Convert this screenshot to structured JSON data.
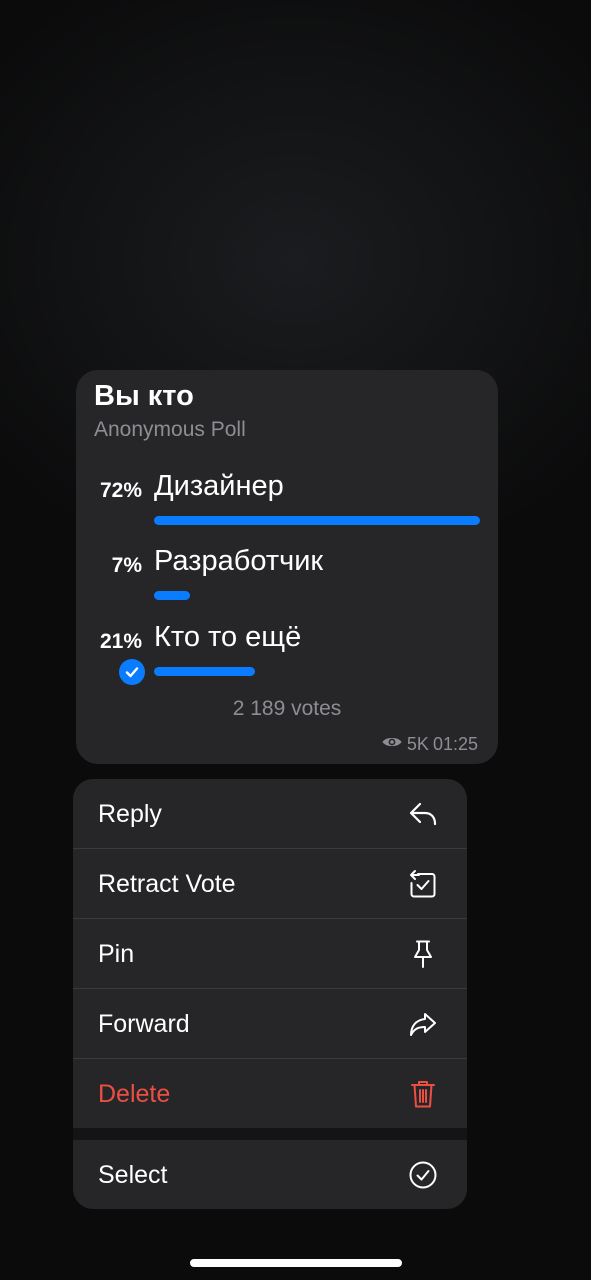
{
  "poll": {
    "title": "Вы кто",
    "subtitle": "Anonymous Poll",
    "options": [
      {
        "percent": "72%",
        "text": "Дизайнер",
        "share": 1.0,
        "selected": false
      },
      {
        "percent": "7%",
        "text": "Разработчик",
        "share": 0.11,
        "selected": false
      },
      {
        "percent": "21%",
        "text": "Кто то ещё",
        "share": 0.31,
        "selected": true
      }
    ],
    "votes": "2 189 votes",
    "views": "5K",
    "time": "01:25"
  },
  "menu": {
    "items": [
      {
        "label": "Reply",
        "icon": "reply-icon"
      },
      {
        "label": "Retract Vote",
        "icon": "retract-vote-icon"
      },
      {
        "label": "Pin",
        "icon": "pin-icon"
      },
      {
        "label": "Forward",
        "icon": "forward-icon"
      },
      {
        "label": "Delete",
        "icon": "trash-icon"
      },
      {
        "label": "Select",
        "icon": "select-check-icon"
      }
    ]
  },
  "colors": {
    "accent": "#0a7cff",
    "destructive": "#eb4f44",
    "bubble": "#262628",
    "secondary_text": "#8d8d93"
  }
}
